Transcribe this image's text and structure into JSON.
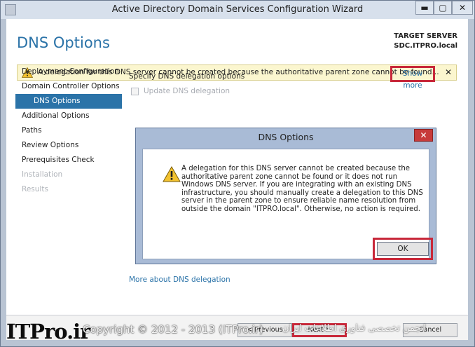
{
  "window": {
    "title": "Active Directory Domain Services Configuration Wizard",
    "controls": {
      "minimize": "▬",
      "maximize": "▢",
      "close": "✕"
    }
  },
  "page": {
    "title": "DNS Options",
    "target_server_label": "TARGET SERVER",
    "target_server_name": "SDC.ITPRO.local"
  },
  "banner": {
    "message": "A delegation for this DNS server cannot be created because the authoritative parent zone cannot be found...",
    "show_more": "Show more",
    "close": "✕"
  },
  "nav": {
    "items": [
      {
        "label": "Deployment Configuration"
      },
      {
        "label": "Domain Controller Options"
      },
      {
        "label": "DNS Options"
      },
      {
        "label": "Additional Options"
      },
      {
        "label": "Paths"
      },
      {
        "label": "Review Options"
      },
      {
        "label": "Prerequisites Check"
      },
      {
        "label": "Installation"
      },
      {
        "label": "Results"
      }
    ]
  },
  "content": {
    "section_label": "Specify DNS delegation options",
    "checkbox_label": "Update DNS delegation",
    "more_link": "More about DNS delegation"
  },
  "footer": {
    "previous": "< Previous",
    "next": "Next >",
    "cancel": "Cancel"
  },
  "watermark": {
    "logo": "ITPro.ir",
    "copyright": "Copyright © 2012 - 2013 (ITPro.ir)",
    "persian": "انجمن تخصصی فناوری اطلاعات ایران"
  },
  "modal": {
    "title": "DNS Options",
    "close": "✕",
    "message": "A delegation for this DNS server cannot be created because the authoritative parent zone cannot be found or it does not run Windows DNS server. If you are integrating with an existing DNS infrastructure, you should manually create a delegation to this DNS server in the parent zone to ensure reliable name resolution from outside the domain \"ITPRO.local\". Otherwise, no action is required.",
    "ok": "OK"
  },
  "colors": {
    "accent": "#2b73a8",
    "highlight": "#c8283a",
    "warning_bg": "#fbf6cf",
    "modal_frame": "#a9bbd6"
  },
  "icons": {
    "warning": "warning-icon",
    "close": "close-icon"
  }
}
